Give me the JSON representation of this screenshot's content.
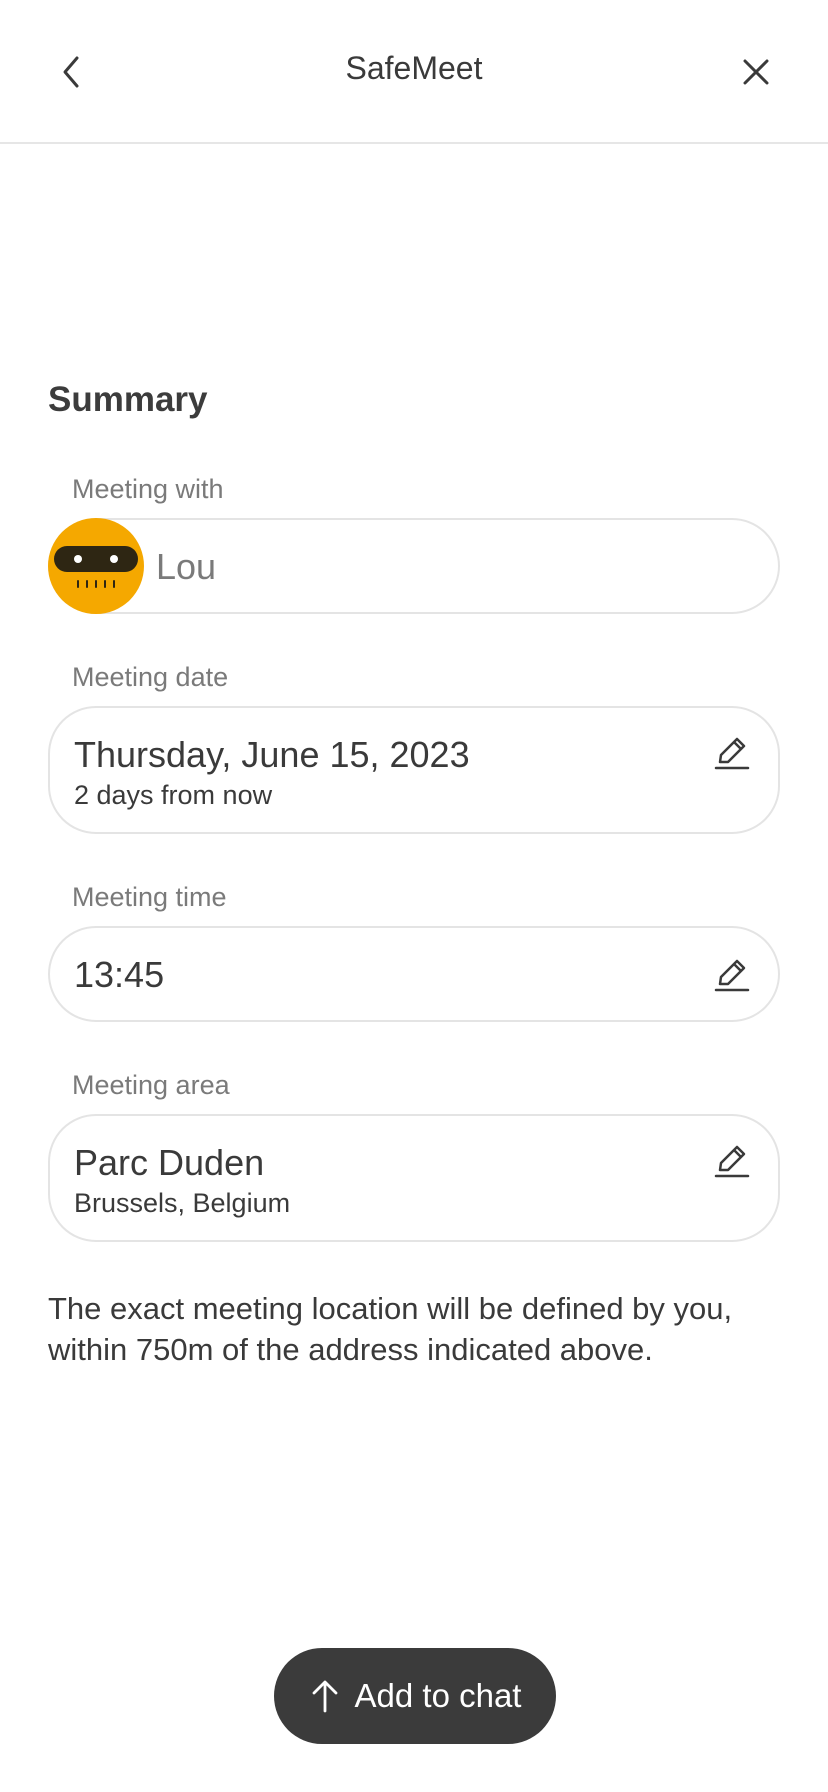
{
  "header": {
    "title": "SafeMeet",
    "back_icon": "chevron-left-icon",
    "close_icon": "close-icon"
  },
  "summary": {
    "heading": "Summary",
    "meeting_with": {
      "label": "Meeting with",
      "name": "Lou",
      "avatar_color": "#f5a800"
    },
    "meeting_date": {
      "label": "Meeting date",
      "value": "Thursday, June 15, 2023",
      "relative": "2 days from now"
    },
    "meeting_time": {
      "label": "Meeting time",
      "value": "13:45"
    },
    "meeting_area": {
      "label": "Meeting area",
      "place": "Parc Duden",
      "city": "Brussels, Belgium"
    },
    "edit_icon": "pencil-icon",
    "note": "The exact meeting location will be defined by you, within 750m of the address indicated above."
  },
  "action": {
    "label": "Add to chat",
    "icon": "arrow-up-icon",
    "bg": "#3b3b3b"
  }
}
